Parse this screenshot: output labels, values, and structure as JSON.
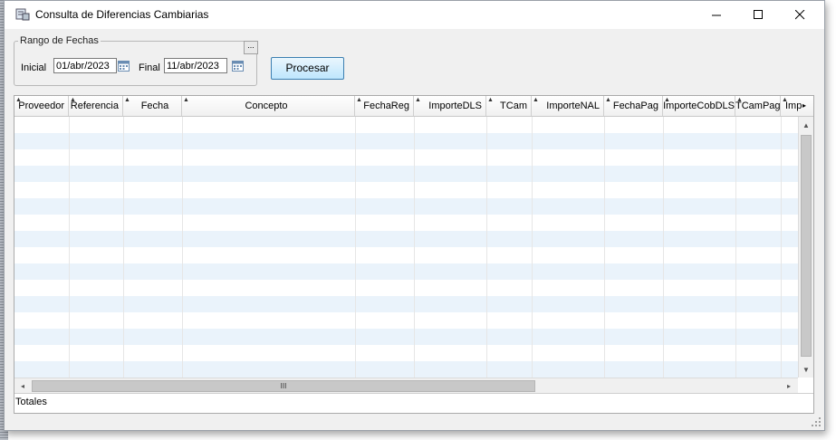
{
  "window": {
    "title": "Consulta de Diferencias Cambiarias"
  },
  "filters": {
    "group_label": "Rango de Fechas",
    "ellipsis_label": "...",
    "start_label": "Inicial",
    "start_value": "01/abr/2023",
    "end_label": "Final",
    "end_value": "11/abr/2023",
    "process_button": "Procesar"
  },
  "grid": {
    "columns": [
      "Proveedor",
      "Referencia",
      "Fecha",
      "Concepto",
      "FechaReg",
      "ImporteDLS",
      "TCam",
      "ImporteNAL",
      "FechaPag",
      "ImporteCobDLS",
      "TCamPag",
      "Imp"
    ],
    "scroll_thumb_label": "III",
    "totals_label": "Totales"
  },
  "colors": {
    "row_alt": "#eaf3fb",
    "button_border": "#3c7fb1"
  }
}
